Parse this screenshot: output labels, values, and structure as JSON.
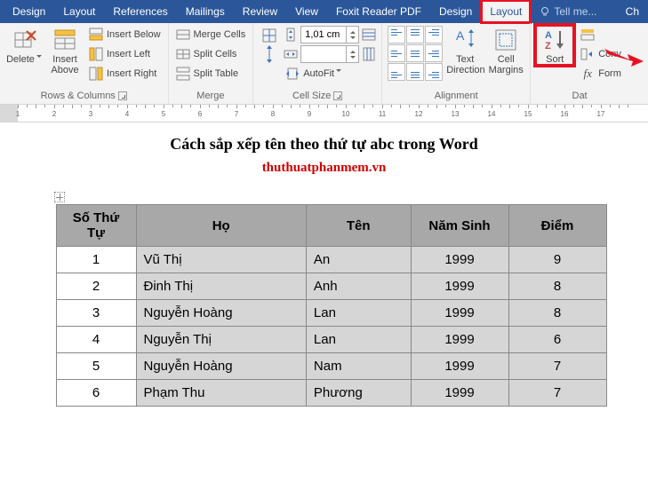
{
  "tabs": {
    "items": [
      "Design",
      "Layout",
      "References",
      "Mailings",
      "Review",
      "View",
      "Foxit Reader PDF",
      "Design",
      "Layout"
    ],
    "active_index": 8,
    "highlight_index": 8,
    "tellme": "Tell me...",
    "extra": "Ch"
  },
  "ribbon": {
    "rows_cols": {
      "label": "Rows & Columns",
      "delete": "Delete",
      "insert_above": "Insert\nAbove",
      "insert_below": "Insert Below",
      "insert_left": "Insert Left",
      "insert_right": "Insert Right"
    },
    "merge": {
      "label": "Merge",
      "merge_cells": "Merge Cells",
      "split_cells": "Split Cells",
      "split_table": "Split Table"
    },
    "cell_size": {
      "label": "Cell Size",
      "height": "1,01 cm",
      "width": "",
      "autofit": "AutoFit"
    },
    "alignment": {
      "label": "Alignment",
      "text_direction": "Text\nDirection",
      "cell_margins": "Cell\nMargins"
    },
    "data": {
      "label": "Dat",
      "sort": "Sort",
      "convert": "Conv",
      "formula": "Form"
    }
  },
  "ruler": {
    "start": 1,
    "end": 17
  },
  "doc": {
    "title": "Cách sắp xếp tên theo thứ tự abc trong Word",
    "subtitle": "thuthuatphanmem.vn",
    "headers": [
      "Số Thứ Tự",
      "Họ",
      "Tên",
      "Năm Sinh",
      "Điểm"
    ],
    "rows": [
      {
        "n": "1",
        "ho": "Vũ Thị",
        "ten": "An",
        "nam": "1999",
        "diem": "9"
      },
      {
        "n": "2",
        "ho": "Đinh Thị",
        "ten": "Anh",
        "nam": "1999",
        "diem": "8"
      },
      {
        "n": "3",
        "ho": "Nguyễn Hoàng",
        "ten": "Lan",
        "nam": "1999",
        "diem": "8"
      },
      {
        "n": "4",
        "ho": "Nguyễn Thị",
        "ten": "Lan",
        "nam": "1999",
        "diem": "6"
      },
      {
        "n": "5",
        "ho": "Nguyễn Hoàng",
        "ten": "Nam",
        "nam": "1999",
        "diem": "7"
      },
      {
        "n": "6",
        "ho": "Phạm Thu",
        "ten": "Phương",
        "nam": "1999",
        "diem": "7"
      }
    ]
  }
}
